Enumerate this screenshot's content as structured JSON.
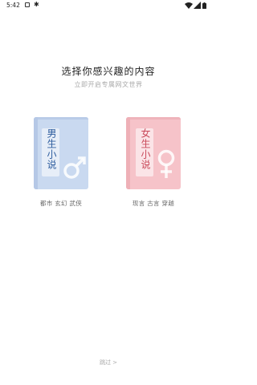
{
  "status_bar": {
    "time": "5:42"
  },
  "header": {
    "title": "选择你感兴趣的内容",
    "subtitle": "立即开启专属网文世界"
  },
  "options": [
    {
      "book_title": "男生小说",
      "tags": "都市 玄幻 武侠",
      "color": "#c9d9f0",
      "text_color": "#2e5d9e"
    },
    {
      "book_title": "女生小说",
      "tags": "现言 古言 穿越",
      "color": "#f6c3c9",
      "text_color": "#c94a5a"
    }
  ],
  "skip_label": "跳过 >"
}
